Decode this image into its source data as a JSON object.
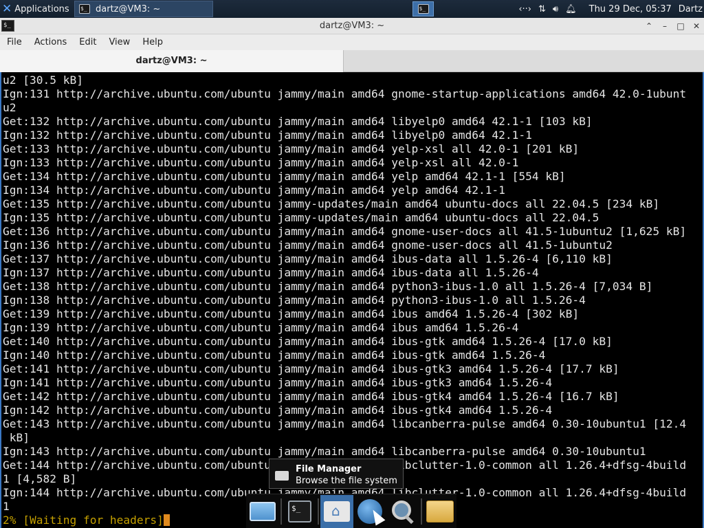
{
  "top_panel": {
    "applications_label": "Applications",
    "task_title": "dartz@VM3: ~",
    "clock": "Thu 29 Dec, 05:37",
    "user": "Dartz",
    "tray_icons": [
      "network-icon",
      "transfer-icon",
      "volume-icon",
      "bell-icon"
    ]
  },
  "window": {
    "title": "dartz@VM3: ~",
    "menu": [
      "File",
      "Actions",
      "Edit",
      "View",
      "Help"
    ],
    "tab_label": "dartz@VM3: ~"
  },
  "terminal": {
    "lines": [
      "u2 [30.5 kB]",
      "Ign:131 http://archive.ubuntu.com/ubuntu jammy/main amd64 gnome-startup-applications amd64 42.0-1ubunt",
      "u2",
      "Get:132 http://archive.ubuntu.com/ubuntu jammy/main amd64 libyelp0 amd64 42.1-1 [103 kB]",
      "Ign:132 http://archive.ubuntu.com/ubuntu jammy/main amd64 libyelp0 amd64 42.1-1",
      "Get:133 http://archive.ubuntu.com/ubuntu jammy/main amd64 yelp-xsl all 42.0-1 [201 kB]",
      "Ign:133 http://archive.ubuntu.com/ubuntu jammy/main amd64 yelp-xsl all 42.0-1",
      "Get:134 http://archive.ubuntu.com/ubuntu jammy/main amd64 yelp amd64 42.1-1 [554 kB]",
      "Ign:134 http://archive.ubuntu.com/ubuntu jammy/main amd64 yelp amd64 42.1-1",
      "Get:135 http://archive.ubuntu.com/ubuntu jammy-updates/main amd64 ubuntu-docs all 22.04.5 [234 kB]",
      "Ign:135 http://archive.ubuntu.com/ubuntu jammy-updates/main amd64 ubuntu-docs all 22.04.5",
      "Get:136 http://archive.ubuntu.com/ubuntu jammy/main amd64 gnome-user-docs all 41.5-1ubuntu2 [1,625 kB]",
      "Ign:136 http://archive.ubuntu.com/ubuntu jammy/main amd64 gnome-user-docs all 41.5-1ubuntu2",
      "Get:137 http://archive.ubuntu.com/ubuntu jammy/main amd64 ibus-data all 1.5.26-4 [6,110 kB]",
      "Ign:137 http://archive.ubuntu.com/ubuntu jammy/main amd64 ibus-data all 1.5.26-4",
      "Get:138 http://archive.ubuntu.com/ubuntu jammy/main amd64 python3-ibus-1.0 all 1.5.26-4 [7,034 B]",
      "Ign:138 http://archive.ubuntu.com/ubuntu jammy/main amd64 python3-ibus-1.0 all 1.5.26-4",
      "Get:139 http://archive.ubuntu.com/ubuntu jammy/main amd64 ibus amd64 1.5.26-4 [302 kB]",
      "Ign:139 http://archive.ubuntu.com/ubuntu jammy/main amd64 ibus amd64 1.5.26-4",
      "Get:140 http://archive.ubuntu.com/ubuntu jammy/main amd64 ibus-gtk amd64 1.5.26-4 [17.0 kB]",
      "Ign:140 http://archive.ubuntu.com/ubuntu jammy/main amd64 ibus-gtk amd64 1.5.26-4",
      "Get:141 http://archive.ubuntu.com/ubuntu jammy/main amd64 ibus-gtk3 amd64 1.5.26-4 [17.7 kB]",
      "Ign:141 http://archive.ubuntu.com/ubuntu jammy/main amd64 ibus-gtk3 amd64 1.5.26-4",
      "Get:142 http://archive.ubuntu.com/ubuntu jammy/main amd64 ibus-gtk4 amd64 1.5.26-4 [16.7 kB]",
      "Ign:142 http://archive.ubuntu.com/ubuntu jammy/main amd64 ibus-gtk4 amd64 1.5.26-4",
      "Get:143 http://archive.ubuntu.com/ubuntu jammy/main amd64 libcanberra-pulse amd64 0.30-10ubuntu1 [12.4",
      " kB]",
      "Ign:143 http://archive.ubuntu.com/ubuntu jammy/main amd64 libcanberra-pulse amd64 0.30-10ubuntu1",
      "Get:144 http://archive.ubuntu.com/ubuntu jammy/main amd64 libclutter-1.0-common all 1.26.4+dfsg-4build",
      "1 [4,582 B]",
      "Ign:144 http://archive.ubuntu.com/ubuntu jammy/main amd64 libclutter-1.0-common all 1.26.4+dfsg-4build",
      "1"
    ],
    "progress": "2% [Waiting for headers]"
  },
  "tooltip": {
    "title": "File Manager",
    "description": "Browse the file system"
  },
  "dock": {
    "items": [
      "desktop-icon",
      "terminal-icon",
      "home-folder-icon",
      "web-browser-icon",
      "app-finder-icon",
      "folder-icon"
    ]
  }
}
